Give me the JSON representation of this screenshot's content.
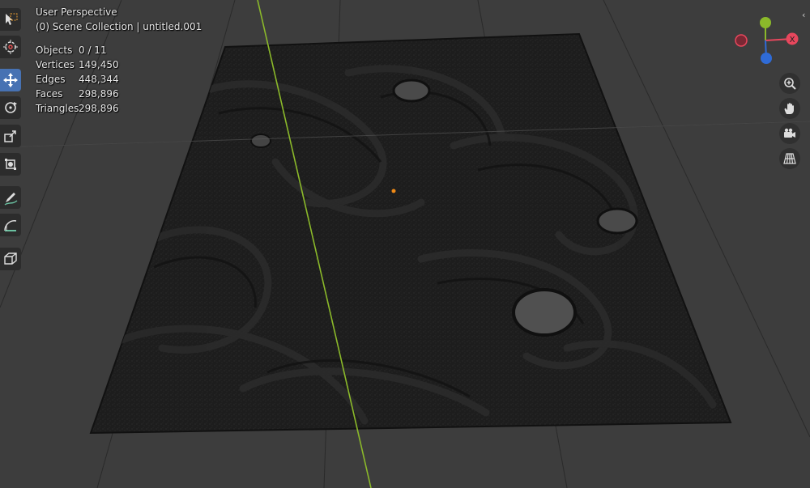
{
  "viewport": {
    "title": "User Perspective",
    "scene_line": "(0) Scene Collection | untitled.001"
  },
  "stats": [
    {
      "label": "Objects",
      "value": "0 / 11"
    },
    {
      "label": "Vertices",
      "value": "149,450"
    },
    {
      "label": "Edges",
      "value": "448,344"
    },
    {
      "label": "Faces",
      "value": "298,896"
    },
    {
      "label": "Triangles",
      "value": "298,896"
    }
  ],
  "toolbar": {
    "tools": [
      "select-box-icon",
      "cursor-icon",
      "move-icon",
      "rotate-icon",
      "scale-icon",
      "transform-icon",
      "annotate-icon",
      "measure-icon",
      "add-cube-icon"
    ],
    "active": "move-icon"
  },
  "gizmo": {
    "x_label": "X",
    "colors": {
      "x": "#e8475d",
      "y": "#8bb92a",
      "z": "#2f6bd6"
    }
  },
  "nav": [
    "zoom-icon",
    "pan-hand-icon",
    "camera-icon",
    "grid-perspective-icon"
  ],
  "colors": {
    "background": "#3d3d3d",
    "mesh": "#1e1e1e",
    "accent": "#4772b3",
    "y_axis_line": "#8bb92a",
    "origin": "#f08a16"
  }
}
